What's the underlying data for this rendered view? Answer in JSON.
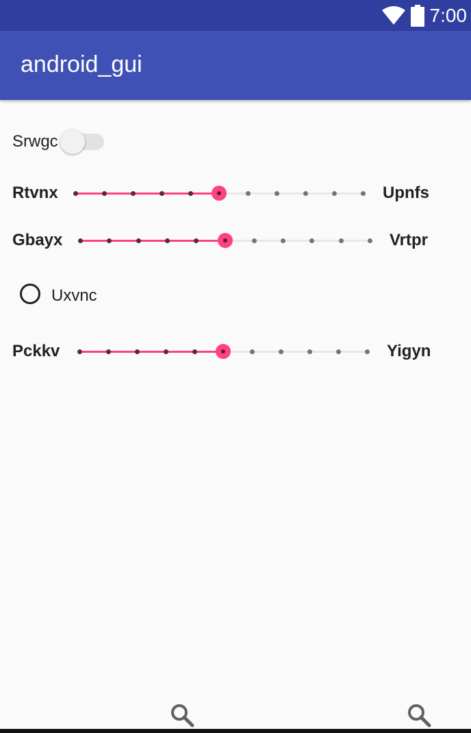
{
  "status_bar": {
    "time": "7:00"
  },
  "app_bar": {
    "title": "android_gui"
  },
  "switch": {
    "label": "Srwgc",
    "checked": false
  },
  "sliders": [
    {
      "left_label": "Rtvnx",
      "right_label": "Upnfs",
      "value": 5,
      "max": 10
    },
    {
      "left_label": "Gbayx",
      "right_label": "Vrtpr",
      "value": 5,
      "max": 10
    },
    {
      "left_label": "Pckkv",
      "right_label": "Yigyn",
      "value": 5,
      "max": 10
    }
  ],
  "radio": {
    "label": "Uxvnc",
    "checked": false
  },
  "bottom_icons": [
    "search-icon",
    "search-icon"
  ],
  "colors": {
    "status_bar": "#303f9f",
    "app_bar": "#3f51b5",
    "accent": "#ff4081"
  }
}
